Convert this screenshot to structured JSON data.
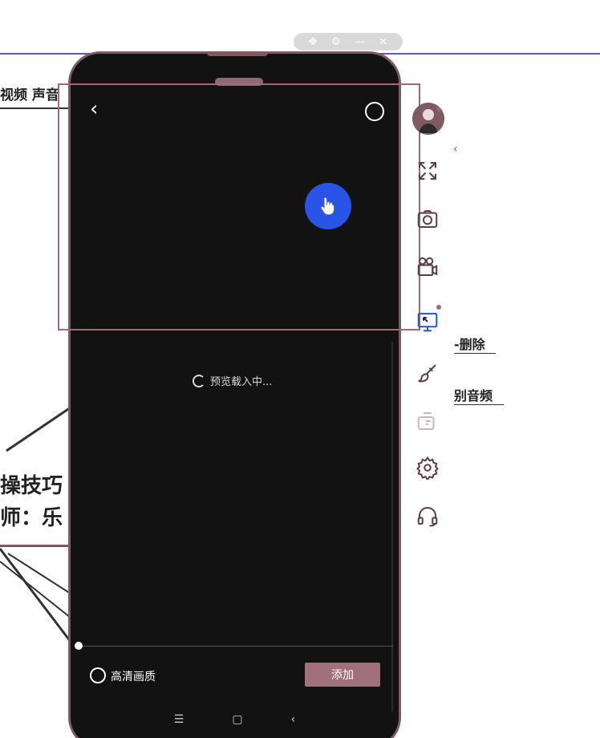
{
  "window_controls": {
    "items": [
      "✥",
      "⚙",
      "—",
      "✕"
    ]
  },
  "background": {
    "top_label": "视频 声音",
    "title_line1": "操技巧",
    "title_line2": "师：乐",
    "right_label1": "-删除",
    "right_label2": "别音频"
  },
  "phone": {
    "loading_text": "预览载入中...",
    "hd_label": "高清画质",
    "add_button": "添加",
    "nav": {
      "menu": "☰",
      "home": "▢",
      "back": "‹"
    }
  },
  "toolbar": {
    "collapse": "‹",
    "tools": [
      "fullscreen-icon",
      "camera-icon",
      "video-camera-icon",
      "screen-record-icon",
      "brush-icon",
      "chat-icon",
      "settings-icon",
      "headset-icon"
    ]
  },
  "colors": {
    "accent": "#9b6b78",
    "phone_bg": "#121212",
    "touch": "#2855e8",
    "rule": "#5b5fb3"
  }
}
